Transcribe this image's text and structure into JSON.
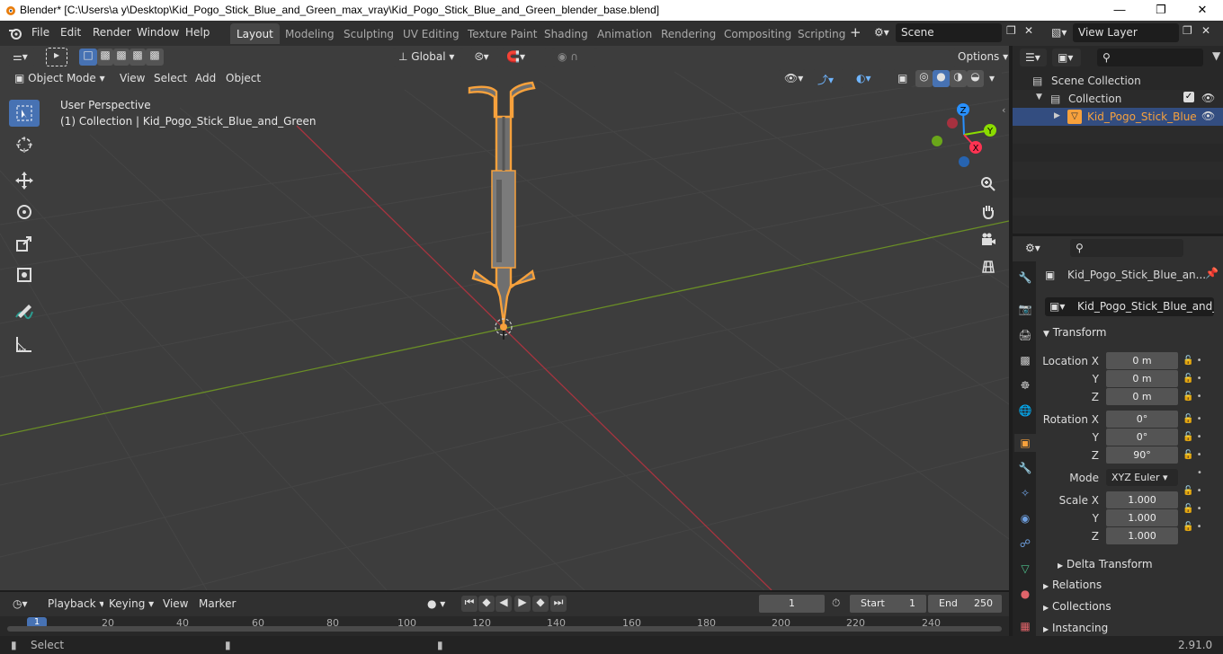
{
  "window": {
    "title": "Blender* [C:\\Users\\a y\\Desktop\\Kid_Pogo_Stick_Blue_and_Green_max_vray\\Kid_Pogo_Stick_Blue_and_Green_blender_base.blend]"
  },
  "menu": [
    "File",
    "Edit",
    "Render",
    "Window",
    "Help"
  ],
  "workspaces": [
    "Layout",
    "Modeling",
    "Sculpting",
    "UV Editing",
    "Texture Paint",
    "Shading",
    "Animation",
    "Rendering",
    "Compositing",
    "Scripting"
  ],
  "scene": {
    "name": "Scene",
    "view_layer": "View Layer"
  },
  "viewport": {
    "transform_orientation": "Global",
    "options_label": "Options",
    "mode": "Object Mode",
    "header_menus": [
      "View",
      "Select",
      "Add",
      "Object"
    ],
    "perspective_label": "User Perspective",
    "collection_label": "(1) Collection | Kid_Pogo_Stick_Blue_and_Green"
  },
  "gizmo": {
    "x": "X",
    "y": "Y",
    "z": "Z"
  },
  "outliner": {
    "scene_collection": "Scene Collection",
    "collection": "Collection",
    "object": "Kid_Pogo_Stick_Blue"
  },
  "properties": {
    "object_name": "Kid_Pogo_Stick_Blue_an...",
    "data_name": "Kid_Pogo_Stick_Blue_and_G...",
    "transform_label": "Transform",
    "location_x_label": "Location X",
    "y_label": "Y",
    "z_label": "Z",
    "location": [
      "0 m",
      "0 m",
      "0 m"
    ],
    "rotation_x_label": "Rotation X",
    "rotation": [
      "0°",
      "0°",
      "90°"
    ],
    "mode_label": "Mode",
    "mode_value": "XYZ Euler",
    "scale_x_label": "Scale X",
    "scale": [
      "1.000",
      "1.000",
      "1.000"
    ],
    "delta_transform": "Delta Transform",
    "relations": "Relations",
    "collections": "Collections",
    "instancing": "Instancing"
  },
  "timeline": {
    "menus": [
      "Playback",
      "Keying",
      "View",
      "Marker"
    ],
    "current_frame": "1",
    "start_label": "Start",
    "start_value": "1",
    "end_label": "End",
    "end_value": "250",
    "ruler": [
      "1",
      "20",
      "40",
      "60",
      "80",
      "100",
      "120",
      "140",
      "160",
      "180",
      "200",
      "220",
      "240"
    ]
  },
  "status": {
    "select_label": "Select",
    "version": "2.91.0"
  },
  "colors": {
    "accent": "#4772b3",
    "selection": "#f7a13c",
    "x_axis": "#ff3352",
    "y_axis": "#8bdc00",
    "z_axis": "#2890ff"
  }
}
